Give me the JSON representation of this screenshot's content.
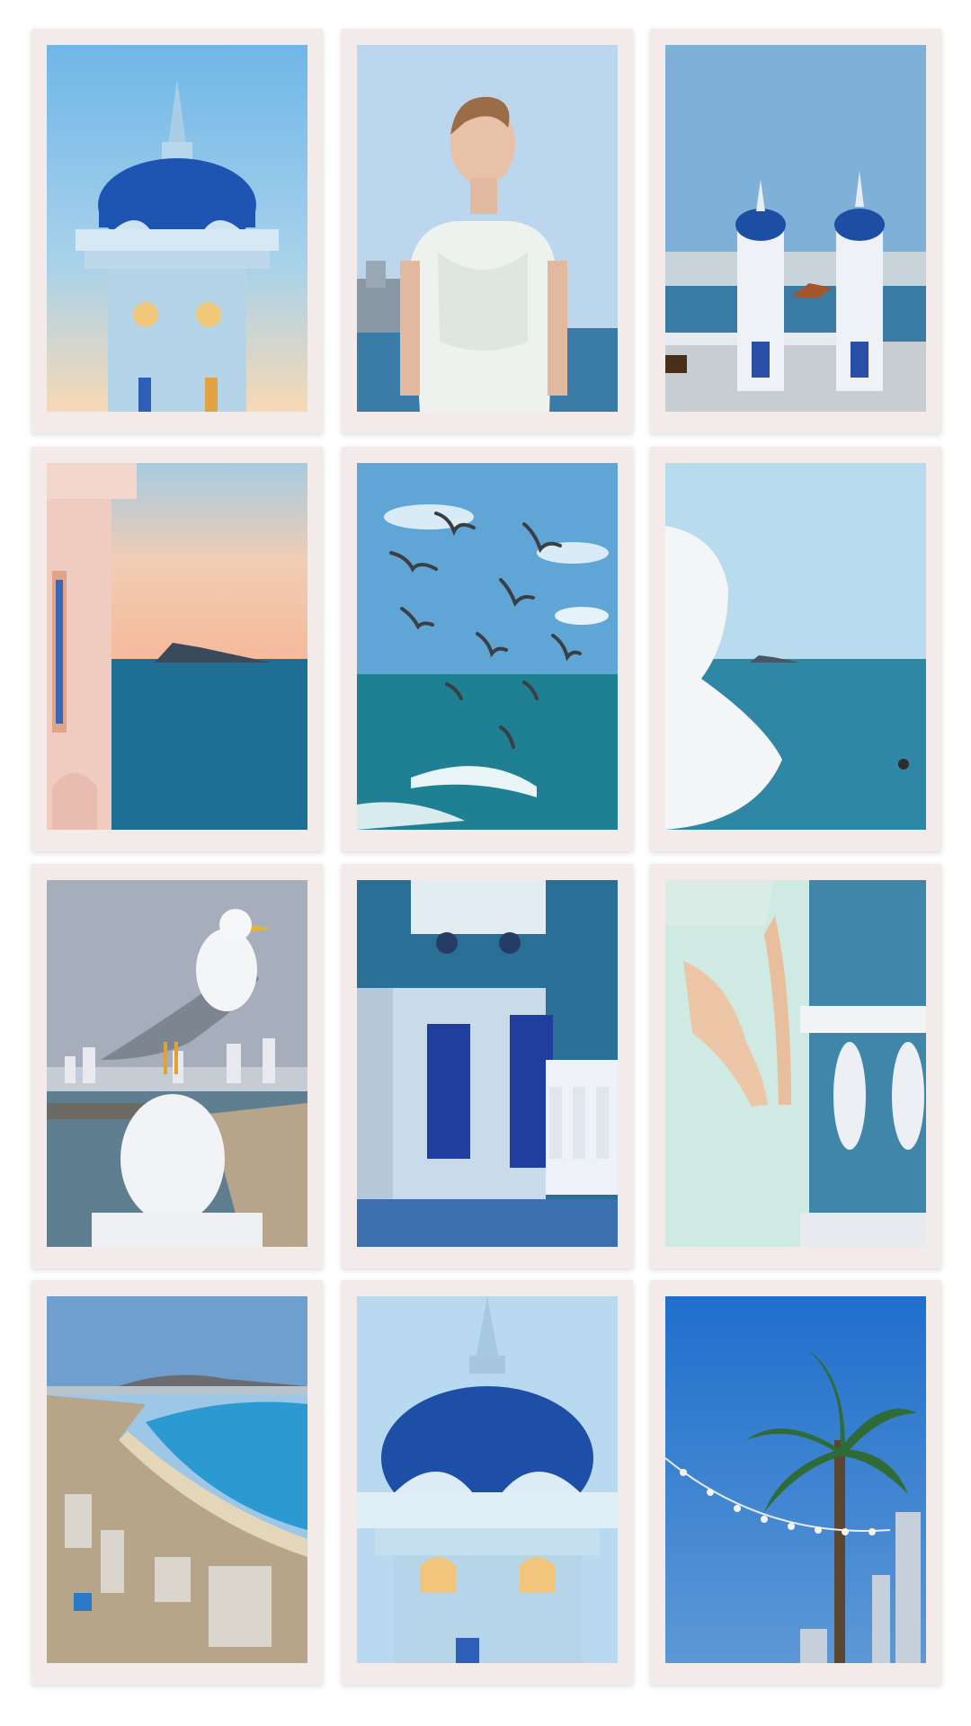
{
  "gallery": {
    "photos": [
      {
        "subject": "blue-dome-tower-sunrise"
      },
      {
        "subject": "woman-lace-dress-sea"
      },
      {
        "subject": "twin-towers-balcony"
      },
      {
        "subject": "column-island-sunset"
      },
      {
        "subject": "seagulls-over-waves"
      },
      {
        "subject": "white-baluster-sea-island"
      },
      {
        "subject": "seagull-on-finial-city"
      },
      {
        "subject": "tiled-pillar-sea"
      },
      {
        "subject": "woman-hands-balustrade"
      },
      {
        "subject": "aerial-beach-city"
      },
      {
        "subject": "blue-dome-tower-closeup"
      },
      {
        "subject": "palm-tree-string-lights"
      }
    ]
  },
  "colors": {
    "frame": "#f3ebea",
    "sky": "#9cc7e6",
    "sea": "#2e7f9e",
    "dome": "#1f4fa3",
    "tower": "#f6f6fa"
  }
}
